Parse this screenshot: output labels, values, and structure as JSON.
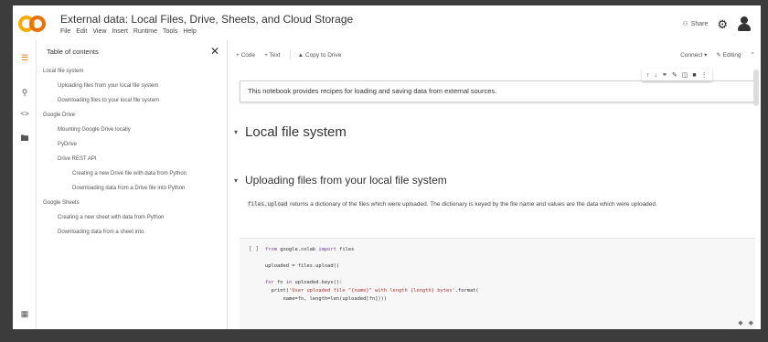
{
  "header": {
    "title": "External data: Local Files, Drive, Sheets, and Cloud Storage",
    "menu": [
      "File",
      "Edit",
      "View",
      "Insert",
      "Runtime",
      "Tools",
      "Help"
    ],
    "share_label": "Share"
  },
  "sidebar": {
    "title": "Table of contents",
    "items": [
      "Local file system",
      "Uploading files from your local file system",
      "Downloading files to your local file system",
      "Google Drive",
      "Mounting Google Drive locally",
      "PyDrive",
      "Drive REST API",
      "Creating a new Drive file with data from Python",
      "Downloading data from a Drive file into Python",
      "Google Sheets",
      "Creating a new sheet with data from Python",
      "Downloading data from a sheet into"
    ]
  },
  "toolbar": {
    "code_label": "+ Code",
    "text_label": "+ Text",
    "copy_label": "Copy to Drive",
    "connect_label": "Connect",
    "editing_label": "Editing"
  },
  "main": {
    "intro": "This notebook provides recipes for loading and saving data from external sources.",
    "h_local": "Local file system",
    "h_upload": "Uploading files from your local file system",
    "para_code": "files.upload",
    "para_text": " returns a dictionary of the files which were uploaded. The dictionary is keyed by the file name and values are the data which were uploaded.",
    "run_label": "[ ]"
  }
}
